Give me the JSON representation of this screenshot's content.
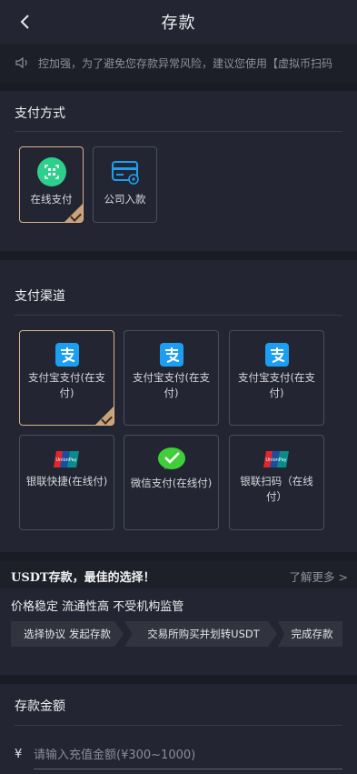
{
  "header": {
    "title": "存款"
  },
  "notice": {
    "text": "控加强，为了避免您存款异常风险，建议您使用【虚拟币扫码"
  },
  "payment_method": {
    "title": "支付方式",
    "items": [
      {
        "label": "在线支付",
        "selected": true,
        "icon": "qr-scan-icon"
      },
      {
        "label": "公司入款",
        "selected": false,
        "icon": "card-gear-icon"
      }
    ]
  },
  "channel": {
    "title": "支付渠道",
    "items": [
      {
        "label": "支付宝支付(在支付)",
        "selected": true,
        "icon": "alipay-icon"
      },
      {
        "label": "支付宝支付(在支付)",
        "selected": false,
        "icon": "alipay-icon"
      },
      {
        "label": "支付宝支付(在支付)",
        "selected": false,
        "icon": "alipay-icon"
      },
      {
        "label": "银联快捷(在线付)",
        "selected": false,
        "icon": "unionpay-icon"
      },
      {
        "label": "微信支付(在线付)",
        "selected": false,
        "icon": "wechat-pay-icon"
      },
      {
        "label": "银联扫码（在线付）",
        "selected": false,
        "icon": "unionpay-icon"
      }
    ]
  },
  "usdt": {
    "title": "USDT存款，最佳的选择！",
    "learn_more": "了解更多 >",
    "features": "价格稳定 流通性高 不受机构监管",
    "steps": [
      "选择协议 发起存款",
      "交易所购买并划转USDT",
      "完成存款"
    ]
  },
  "amount": {
    "title": "存款金额",
    "currency": "¥",
    "placeholder": "请输入充值金额(¥300~1000)"
  },
  "colors": {
    "background": "#232632",
    "selected_border": "#d8b48a",
    "alipay": "#1c9ff0",
    "wechat": "#3fcf3a"
  }
}
